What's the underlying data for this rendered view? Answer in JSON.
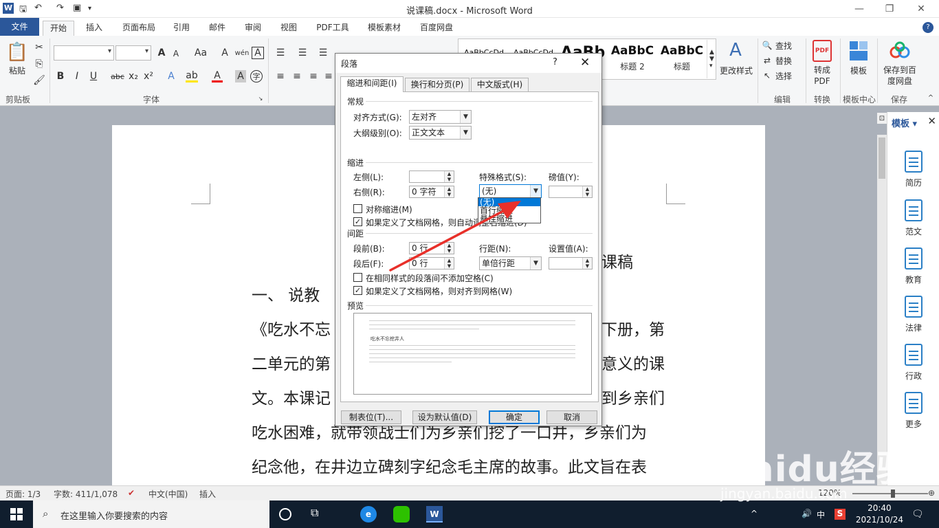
{
  "window": {
    "title": "说课稿.docx - Microsoft Word",
    "app_icon": "W"
  },
  "ribbon_tabs": [
    "文件",
    "开始",
    "插入",
    "页面布局",
    "引用",
    "邮件",
    "审阅",
    "视图",
    "PDF工具",
    "模板素材",
    "百度网盘"
  ],
  "ribbon": {
    "paste_label": "粘贴",
    "clipboard_group": "剪贴板",
    "font_group": "字体",
    "styles": [
      {
        "sample": "AaBbCcDd",
        "name": ""
      },
      {
        "sample": "AaBbCcDd",
        "name": ""
      },
      {
        "sample": "AaBb",
        "name": ""
      },
      {
        "sample": "AaBbC",
        "name": "标题 2"
      },
      {
        "sample": "AaBbC",
        "name": "标题"
      }
    ],
    "change_styles_label": "更改样式",
    "find_label": "查找",
    "replace_label": "替换",
    "select_label": "选择",
    "editing_group": "编辑",
    "convert_label": "转成\nPDF",
    "convert_group": "转换",
    "template_label": "模板",
    "template_group": "模板中心",
    "save_baidu_label": "保存到百度网盘",
    "save_group": "保存"
  },
  "document": {
    "heading_fragment": "课稿",
    "lines": [
      "一、    说教",
      "《吃水不忘",
      "二单元的第",
      "文。本课记",
      "吃水困难，就带领战士们为乡亲们挖了一口井，乡亲们为",
      "纪念他，在井边立碑刻字纪念毛主席的故事。此文旨在表"
    ],
    "right_fragments": [
      "下册，第",
      "意义的课",
      "到乡亲们"
    ]
  },
  "side_pane": {
    "title": "模板",
    "items": [
      "简历",
      "范文",
      "教育",
      "法律",
      "行政",
      "更多"
    ]
  },
  "status_bar": {
    "page": "页面: 1/3",
    "words": "字数: 411/1,078",
    "language": "中文(中国)",
    "mode": "插入",
    "zoom": "120%"
  },
  "taskbar": {
    "search_placeholder": "在这里输入你要搜索的内容",
    "time": "20:40",
    "date": "2021/10/24",
    "ime": "中"
  },
  "dialog": {
    "title": "段落",
    "help": "?",
    "tabs": [
      "缩进和间距(I)",
      "换行和分页(P)",
      "中文版式(H)"
    ],
    "general_section": "常规",
    "alignment_label": "对齐方式(G):",
    "alignment_value": "左对齐",
    "outline_label": "大纲级别(O):",
    "outline_value": "正文文本",
    "indent_section": "缩进",
    "left_label": "左侧(L):",
    "left_value": "",
    "right_label": "右侧(R):",
    "right_value": "0 字符",
    "special_label": "特殊格式(S):",
    "special_value": "(无)",
    "by_label": "磅值(Y):",
    "by_value": "",
    "mirror_indent": "对称缩进(M)",
    "auto_adjust": "如果定义了文档网格，则自动调整右缩进(D)",
    "spacing_section": "间距",
    "before_label": "段前(B):",
    "before_value": "0 行",
    "after_label": "段后(F):",
    "after_value": "0 行",
    "line_spacing_label": "行距(N):",
    "line_spacing_value": "单倍行距",
    "at_label": "设置值(A):",
    "at_value": "",
    "no_space_same_style": "在相同样式的段落间不添加空格(C)",
    "snap_to_grid": "如果定义了文档网格，则对齐到网格(W)",
    "preview_section": "预览",
    "preview_sample": "吃水不忘挖井人",
    "tabs_button": "制表位(T)...",
    "default_button": "设为默认值(D)",
    "ok_button": "确定",
    "cancel_button": "取消"
  },
  "special_dropdown": {
    "options": [
      "(无)",
      "首行缩进",
      "悬挂缩进"
    ],
    "selected": "(无)"
  },
  "colors": {
    "accent": "#2b579a",
    "selection": "#0078d7",
    "arrow": "#e8302a"
  },
  "watermark": {
    "brand": "Baidu经验",
    "url": "jingyan.baidu.com"
  }
}
